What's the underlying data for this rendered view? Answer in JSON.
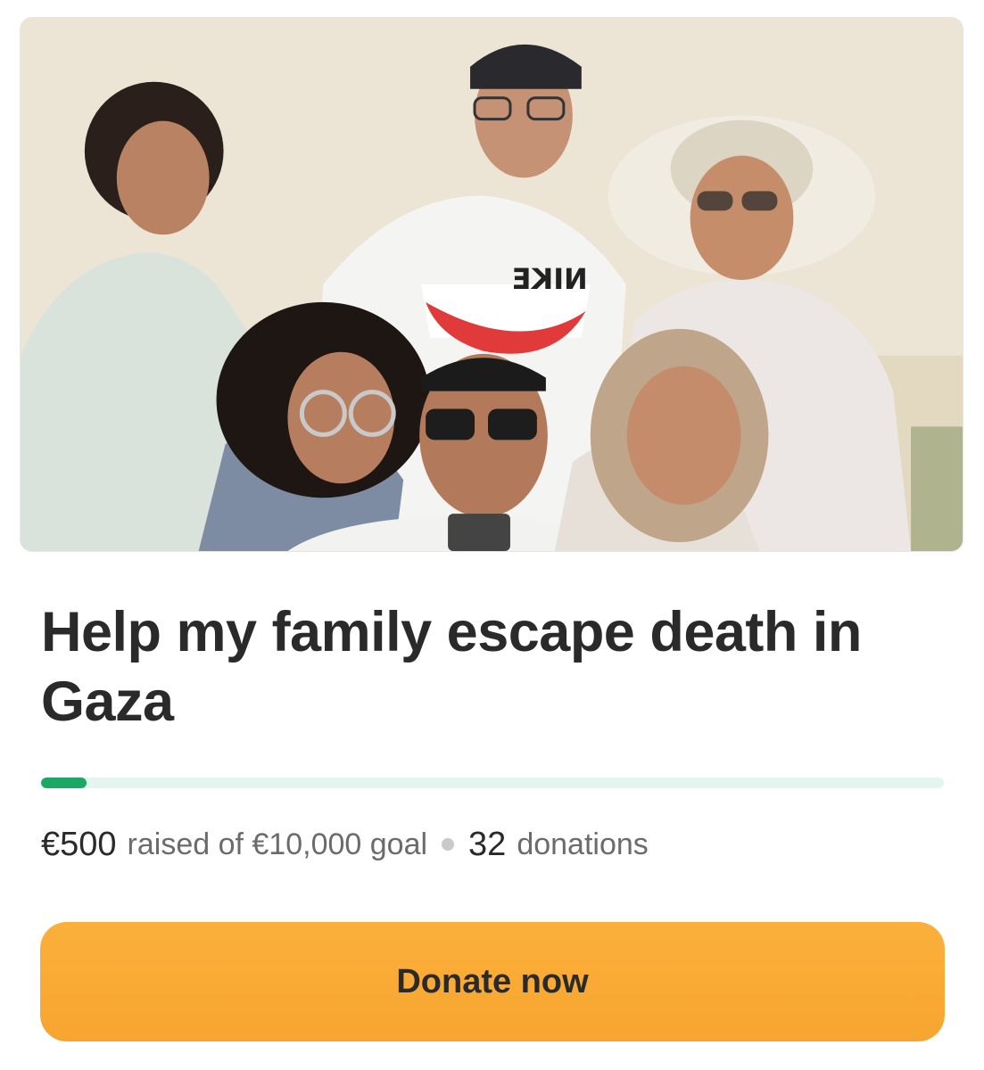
{
  "campaign": {
    "photo_icon": "family-photo",
    "shirt_logo_text": "NIKE",
    "title": "Help my family escape death in Gaza",
    "progress_fraction": 0.05,
    "raised": "€500",
    "raised_of_goal": "raised of €10,000 goal",
    "donations_count": "32",
    "donations_label": "donations",
    "donate_label": "Donate now"
  },
  "colors": {
    "progress_fill": "#1aa865",
    "progress_track": "#e4f4ee",
    "button": "#f7a530"
  }
}
